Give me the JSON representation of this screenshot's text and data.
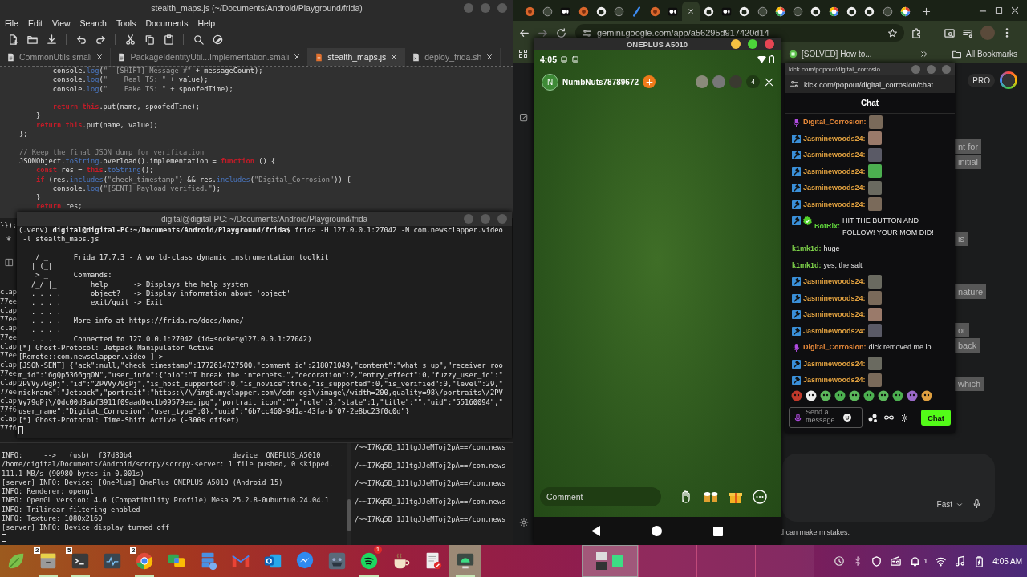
{
  "editor": {
    "title": "stealth_maps.js (~/Documents/Android/Playground/frida)",
    "menu": [
      "File",
      "Edit",
      "View",
      "Search",
      "Tools",
      "Documents",
      "Help"
    ],
    "tabs": [
      {
        "label": "CommonUtils.smali",
        "kind": "document",
        "selected": false
      },
      {
        "label": "PackageIdentityUtil...Implementation.smali",
        "kind": "document",
        "selected": false
      },
      {
        "label": "stealth_maps.js",
        "kind": "script",
        "selected": true
      },
      {
        "label": "deploy_frida.sh",
        "kind": "shell",
        "selected": false
      }
    ],
    "code": [
      {
        "kind": "code",
        "tokens": [
          {
            "kind": "plain",
            "text": "        console."
          },
          {
            "kind": "method",
            "text": "log"
          },
          {
            "kind": "plain",
            "text": "("
          },
          {
            "kind": "string",
            "text": "\"  [SHIFT] Message #\""
          },
          {
            "kind": "plain",
            "text": " + messageCount);"
          }
        ]
      },
      {
        "kind": "code",
        "tokens": [
          {
            "kind": "plain",
            "text": "        console."
          },
          {
            "kind": "method",
            "text": "log"
          },
          {
            "kind": "plain",
            "text": "("
          },
          {
            "kind": "string",
            "text": "\"    Real TS: \""
          },
          {
            "kind": "plain",
            "text": " + value);"
          }
        ]
      },
      {
        "kind": "code",
        "tokens": [
          {
            "kind": "plain",
            "text": "        console."
          },
          {
            "kind": "method",
            "text": "log"
          },
          {
            "kind": "plain",
            "text": "("
          },
          {
            "kind": "string",
            "text": "\"    Fake TS: \""
          },
          {
            "kind": "plain",
            "text": " + spoofedTime);"
          }
        ]
      },
      {
        "kind": "blank"
      },
      {
        "kind": "code",
        "tokens": [
          {
            "kind": "keyword",
            "text": "        return this"
          },
          {
            "kind": "plain",
            "text": ".put(name, spoofedTime);"
          }
        ]
      },
      {
        "kind": "code",
        "tokens": [
          {
            "kind": "plain",
            "text": "    }"
          }
        ]
      },
      {
        "kind": "code",
        "tokens": [
          {
            "kind": "keyword",
            "text": "    return this"
          },
          {
            "kind": "plain",
            "text": ".put(name, value);"
          }
        ]
      },
      {
        "kind": "code",
        "tokens": [
          {
            "kind": "plain",
            "text": "};"
          }
        ]
      },
      {
        "kind": "blank"
      },
      {
        "kind": "code",
        "tokens": [
          {
            "kind": "comment",
            "text": "// Keep the final JSON dump for verification"
          }
        ]
      },
      {
        "kind": "code",
        "tokens": [
          {
            "kind": "plain",
            "text": "JSONObject."
          },
          {
            "kind": "method",
            "text": "toString"
          },
          {
            "kind": "plain",
            "text": ".overload().implementation = "
          },
          {
            "kind": "keyword",
            "text": "function"
          },
          {
            "kind": "plain",
            "text": " () {"
          }
        ]
      },
      {
        "kind": "code",
        "tokens": [
          {
            "kind": "keyword",
            "text": "    const"
          },
          {
            "kind": "plain",
            "text": " res = "
          },
          {
            "kind": "keyword",
            "text": "this"
          },
          {
            "kind": "plain",
            "text": "."
          },
          {
            "kind": "method",
            "text": "toString"
          },
          {
            "kind": "plain",
            "text": "();"
          }
        ]
      },
      {
        "kind": "code",
        "tokens": [
          {
            "kind": "keyword",
            "text": "    if"
          },
          {
            "kind": "plain",
            "text": " (res."
          },
          {
            "kind": "method",
            "text": "includes"
          },
          {
            "kind": "plain",
            "text": "("
          },
          {
            "kind": "string",
            "text": "\"check_timestamp\""
          },
          {
            "kind": "plain",
            "text": ") && res."
          },
          {
            "kind": "method",
            "text": "includes"
          },
          {
            "kind": "plain",
            "text": "("
          },
          {
            "kind": "string",
            "text": "\"Digital_Corrosion\""
          },
          {
            "kind": "plain",
            "text": ")) {"
          }
        ]
      },
      {
        "kind": "code",
        "tokens": [
          {
            "kind": "plain",
            "text": "        console."
          },
          {
            "kind": "method",
            "text": "log"
          },
          {
            "kind": "plain",
            "text": "("
          },
          {
            "kind": "string",
            "text": "\"[SENT] Payload verified.\""
          },
          {
            "kind": "plain",
            "text": ");"
          }
        ]
      },
      {
        "kind": "code",
        "tokens": [
          {
            "kind": "plain",
            "text": "    }"
          }
        ]
      },
      {
        "kind": "code",
        "tokens": [
          {
            "kind": "keyword",
            "text": "    return"
          },
          {
            "kind": "plain",
            "text": " res;"
          }
        ]
      }
    ]
  },
  "back_terminal": {
    "top_text": "}});",
    "lines": [
      "clap",
      "77ee",
      "clap",
      "77ee",
      "clap",
      "77ee",
      "clap",
      "77ee",
      "clap",
      "77ee",
      "clap",
      "77ee",
      "clap",
      "77f6",
      "clap",
      "77f6"
    ],
    "log": [
      "INFO:     -->   (usb)  f37d80b4                        device  ONEPLUS_A5010",
      "/home/digital/Documents/Android/scrcpy/scrcpy-server: 1 file pushed, 0 skipped.",
      "111.1 MB/s (90980 bytes in 0.001s)",
      "[server] INFO: Device: [OnePlus] OnePlus ONEPLUS A5010 (Android 15)",
      "INFO: Renderer: opengl",
      "INFO: OpenGL version: 4.6 (Compatibility Profile) Mesa 25.2.8-0ubuntu0.24.04.1",
      "INFO: Trilinear filtering enabled",
      "INFO: Texture: 1080x2160",
      "[server] INFO: Device display turned off"
    ],
    "side_log": [
      "/~~I7Kq5D_1J1tgJJeMToj2pA==/com.news",
      "/~~I7Kq5D_1J1tgJJeMToj2pA==/com.news",
      "/~~I7Kq5D_1J1tgJJeMToj2pA==/com.news",
      "/~~I7Kq5D_1J1tgJJeMToj2pA==/com.news",
      "/~~I7Kq5D_1J1tgJJeMToj2pA==/com.news"
    ],
    "cursor": true
  },
  "terminal": {
    "title": "digital@digital-PC: ~/Documents/Android/Playground/frida",
    "lines": [
      {
        "kind": "prompt",
        "env": "(.venv)",
        "prompt": "digital@digital-PC:~/Documents/Android/Playground/frida$",
        "command": "frida -H 127.0.0.1:27042 -N com.newsclapper.video"
      },
      {
        "kind": "output",
        "text": " -l stealth_maps.js"
      },
      {
        "kind": "output",
        "text": "     ____"
      },
      {
        "kind": "output",
        "text": "    / _  |   Frida 17.7.3 - A world-class dynamic instrumentation toolkit"
      },
      {
        "kind": "output",
        "text": "   | (_| |"
      },
      {
        "kind": "output",
        "text": "    > _  |   Commands:"
      },
      {
        "kind": "output",
        "text": "   /_/ |_|       help      -> Displays the help system"
      },
      {
        "kind": "output",
        "text": "   . . . .       object?   -> Display information about 'object'"
      },
      {
        "kind": "output",
        "text": "   . . . .       exit/quit -> Exit"
      },
      {
        "kind": "output",
        "text": "   . . . ."
      },
      {
        "kind": "output",
        "text": "   . . . .   More info at https://frida.re/docs/home/"
      },
      {
        "kind": "output",
        "text": "   . . . ."
      },
      {
        "kind": "output",
        "text": "   . . . .   Connected to 127.0.0.1:27042 (id=socket@127.0.0.1:27042)"
      },
      {
        "kind": "output",
        "text": "[*] Ghost-Protocol: Jetpack Manipulator Active"
      },
      {
        "kind": "output",
        "text": "[Remote::com.newsclapper.video ]->"
      },
      {
        "kind": "output",
        "text": "[JSON-SENT] {\"ack\":null,\"check_timestamp\":1772614727500,\"comment_id\":218071049,\"content\":\"what's up\",\"receiver_roo"
      },
      {
        "kind": "output",
        "text": "m_id\":\"6gQp5366gqON\",\"user_info\":{\"bio\":\"I break the internets.\",\"decoration\":2,\"entry_effect\":0,\"fuzzy_user_id\":\""
      },
      {
        "kind": "output",
        "text": "2PVVy79gPj\",\"id\":\"2PVVy79gPj\",\"is_host_supported\":0,\"is_novice\":true,\"is_supported\":0,\"is_verified\":0,\"level\":29,\""
      },
      {
        "kind": "output",
        "text": "nickname\":\"Jetpack\",\"portrait\":\"https:\\/\\/img6.myclapper.com\\/cdn-cgi\\/image\\/width=200,quality=98\\/portraits\\/2PV"
      },
      {
        "kind": "output",
        "text": "Vy79gPj\\/0dc00d3abf3911f09aad0ec1b09579ee.jpg\",\"portrait_icon\":\"\",\"role\":3,\"state\":1,\"title\":\"\",\"uid\":\"55160094\",\""
      },
      {
        "kind": "output",
        "text": "user_name\":\"Digital_Corrosion\",\"user_type\":0},\"uuid\":\"6b7cc460-941a-43fa-bf07-2e8bc23f0c0d\"}"
      },
      {
        "kind": "output",
        "text": "[*] Ghost-Protocol: Time-Shift Active (-300s offset)"
      }
    ],
    "cursor": true
  },
  "browser": {
    "tabs": [
      {
        "kind": "orange",
        "selected": false
      },
      {
        "kind": "grey",
        "selected": false
      },
      {
        "kind": "medium",
        "selected": false
      },
      {
        "kind": "orange",
        "selected": false
      },
      {
        "kind": "github",
        "selected": false
      },
      {
        "kind": "grey",
        "selected": false
      },
      {
        "kind": "blue",
        "selected": false
      },
      {
        "kind": "orange",
        "selected": false
      },
      {
        "kind": "medium",
        "selected": false
      },
      {
        "selected": true
      },
      {
        "kind": "github",
        "selected": false
      },
      {
        "kind": "medium",
        "selected": false
      },
      {
        "kind": "github",
        "selected": false
      },
      {
        "kind": "grey",
        "selected": false
      },
      {
        "kind": "google",
        "selected": false
      },
      {
        "kind": "grey",
        "selected": false
      },
      {
        "kind": "github",
        "selected": false
      },
      {
        "kind": "google",
        "selected": false
      },
      {
        "kind": "github",
        "selected": false
      },
      {
        "kind": "github",
        "selected": false
      },
      {
        "kind": "grey",
        "selected": false
      },
      {
        "kind": "google",
        "selected": false
      }
    ],
    "url": "gemini.google.com/app/a56295d917420d14",
    "bookmarks": [
      {
        "label": "[SOLVED] How to..."
      }
    ],
    "bookmarks_folder": "All Bookmarks",
    "page": {
      "badge": "PRO",
      "fragments": [
        "nt for",
        "initial",
        "is",
        "nature",
        "or",
        "back",
        "which"
      ],
      "model": "Fast",
      "disclaimer": "d can make mistakes."
    }
  },
  "phone": {
    "title": "ONEPLUS A5010",
    "time": "4:05",
    "user": {
      "initial": "N",
      "name": "NumbNuts78789672"
    },
    "viewer_count": "4",
    "comment_placeholder": "Comment"
  },
  "chat": {
    "title": "kick.com/popout/digital_corrosio...",
    "url": "kick.com/popout/digital_corrosion/chat",
    "header": "Chat",
    "messages": [
      {
        "user": "Digital_Corrosion:",
        "kind": "broadcaster",
        "verified": false,
        "color": "#e98a3a",
        "emote": true
      },
      {
        "user": "Jasminewoods24:",
        "kind": "moderator",
        "verified": false,
        "color": "#e4a340",
        "emote": true
      },
      {
        "user": "Jasminewoods24:",
        "kind": "moderator",
        "verified": false,
        "color": "#e4a340",
        "emote": true
      },
      {
        "user": "Jasminewoods24:",
        "kind": "moderator",
        "verified": false,
        "color": "#e4a340",
        "emote": true
      },
      {
        "user": "Jasminewoods24:",
        "kind": "moderator",
        "verified": false,
        "color": "#e4a340",
        "emote": true
      },
      {
        "user": "Jasminewoods24:",
        "kind": "moderator",
        "verified": false,
        "color": "#e4a340",
        "emote": true
      },
      {
        "user": "BotRix:",
        "kind": "moderator",
        "verified": true,
        "color": "#5fd33b",
        "text": "HIT THE BUTTON AND FOLLOW! YOUR MOM DID!",
        "emote": false
      },
      {
        "user": "k1mk1d:",
        "kind": "viewer",
        "verified": false,
        "color": "#7ed24a",
        "text": "huge",
        "emote": false
      },
      {
        "user": "k1mk1d:",
        "kind": "viewer",
        "verified": false,
        "color": "#7ed24a",
        "text": "yes, the salt",
        "emote": false
      },
      {
        "user": "Jasminewoods24:",
        "kind": "moderator",
        "verified": false,
        "color": "#e4a340",
        "emote": true
      },
      {
        "user": "Jasminewoods24:",
        "kind": "moderator",
        "verified": false,
        "color": "#e4a340",
        "emote": true
      },
      {
        "user": "Jasminewoods24:",
        "kind": "moderator",
        "verified": false,
        "color": "#e4a340",
        "emote": true
      },
      {
        "user": "Jasminewoods24:",
        "kind": "moderator",
        "verified": false,
        "color": "#e4a340",
        "emote": true
      },
      {
        "user": "Digital_Corrosion:",
        "kind": "broadcaster",
        "verified": false,
        "color": "#e98a3a",
        "text": "dick removed me lol",
        "emote": false
      },
      {
        "user": "Jasminewoods24:",
        "kind": "moderator",
        "verified": false,
        "color": "#e4a340",
        "emote": true
      },
      {
        "user": "Jasminewoods24:",
        "kind": "moderator",
        "verified": false,
        "color": "#e4a340",
        "emote": true
      }
    ],
    "input_placeholder": "Send a message",
    "send_label": "Chat"
  },
  "taskbar": {
    "apps": [
      {
        "kind": "leaf",
        "running": false,
        "active": false
      },
      {
        "kind": "files",
        "windows": "2",
        "running": true,
        "active": false
      },
      {
        "kind": "terminal",
        "windows": "5",
        "running": true,
        "active": false
      },
      {
        "kind": "monitor",
        "running": false,
        "active": false
      },
      {
        "kind": "chrome",
        "windows": "2",
        "running": true,
        "active": false
      },
      {
        "kind": "chat",
        "running": false,
        "active": false
      },
      {
        "kind": "server",
        "running": false,
        "active": false
      },
      {
        "kind": "mail",
        "running": false,
        "active": false
      },
      {
        "kind": "outlook",
        "running": false,
        "active": false
      },
      {
        "kind": "messenger",
        "running": false,
        "active": false
      },
      {
        "kind": "game",
        "running": false,
        "active": false
      },
      {
        "kind": "spotify",
        "notifications": "1",
        "running": true,
        "active": false
      },
      {
        "kind": "coffee",
        "running": false,
        "active": false
      },
      {
        "kind": "notes",
        "running": false,
        "active": false
      },
      {
        "kind": "android",
        "running": true,
        "active": true
      }
    ],
    "notifications": "1",
    "clock": "4:05 AM"
  }
}
